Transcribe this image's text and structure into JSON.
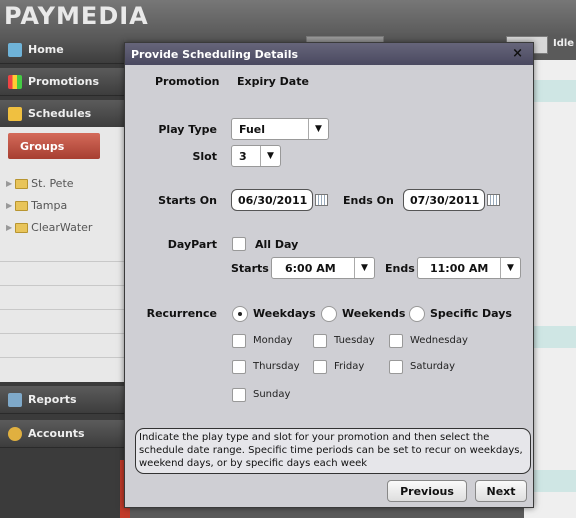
{
  "app": {
    "brand": "PAYMEDIA",
    "idle_label": "Idle"
  },
  "nav": {
    "home": "Home",
    "promotions": "Promotions",
    "schedules": "Schedules",
    "groups_tab": "Groups",
    "groups": [
      "St. Pete",
      "Tampa",
      "ClearWater"
    ],
    "reports": "Reports",
    "accounts": "Accounts"
  },
  "modal": {
    "title": "Provide Scheduling Details",
    "close": "×",
    "promotion_label": "Promotion",
    "promotion_value": "Expiry Date",
    "play_type_label": "Play Type",
    "play_type_value": "Fuel",
    "slot_label": "Slot",
    "slot_value": "3",
    "starts_on_label": "Starts On",
    "starts_on_value": "06/30/2011",
    "ends_on_label": "Ends On",
    "ends_on_value": "07/30/2011",
    "daypart_label": "DayPart",
    "all_day_label": "All Day",
    "starts_label": "Starts",
    "starts_value": "6:00 AM",
    "ends_label": "Ends",
    "ends_value": "11:00 AM",
    "recurrence_label": "Recurrence",
    "recurrence_options": [
      "Weekdays",
      "Weekends",
      "Specific Days"
    ],
    "recurrence_selected": "Weekdays",
    "days": [
      "Monday",
      "Tuesday",
      "Wednesday",
      "Thursday",
      "Friday",
      "Saturday",
      "Sunday"
    ],
    "info_text": "Indicate the play type and slot for your promotion and then select the schedule date range.  Specific time periods can be set to recur on weekdays, weekend days, or by specific days each week",
    "previous_button": "Previous",
    "next_button": "Next"
  },
  "colors": {
    "title_bar": "#55546a",
    "groups_tab": "#b84a3b",
    "modal_bg": "#cfcfd4"
  }
}
